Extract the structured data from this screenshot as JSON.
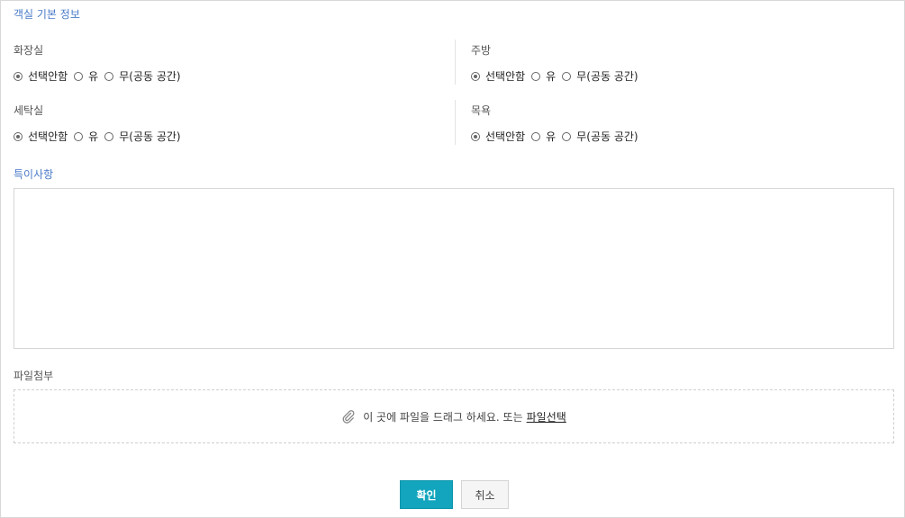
{
  "sections": {
    "basic_info_title": "객실 기본 정보",
    "notes_title": "특이사항",
    "attachment_title": "파일첨부"
  },
  "fields": {
    "bathroom": {
      "label": "화장실",
      "options": [
        "선택안함",
        "유",
        "무(공동 공간)"
      ],
      "selected": "선택안함"
    },
    "kitchen": {
      "label": "주방",
      "options": [
        "선택안함",
        "유",
        "무(공동 공간)"
      ],
      "selected": "선택안함"
    },
    "laundry": {
      "label": "세탁실",
      "options": [
        "선택안함",
        "유",
        "무(공동 공간)"
      ],
      "selected": "선택안함"
    },
    "shower": {
      "label": "목욕",
      "options": [
        "선택안함",
        "유",
        "무(공동 공간)"
      ],
      "selected": "선택안함"
    }
  },
  "notes": {
    "value": "",
    "placeholder": ""
  },
  "attachment": {
    "drop_text": "이 곳에 파일을 드래그 하세요. 또는",
    "select_link": "파일선택"
  },
  "buttons": {
    "confirm": "확인",
    "cancel": "취소"
  },
  "colors": {
    "accent_title": "#4a7bc8",
    "confirm_button": "#12a5bd"
  },
  "icons": {
    "attachment": "paperclip-icon"
  }
}
